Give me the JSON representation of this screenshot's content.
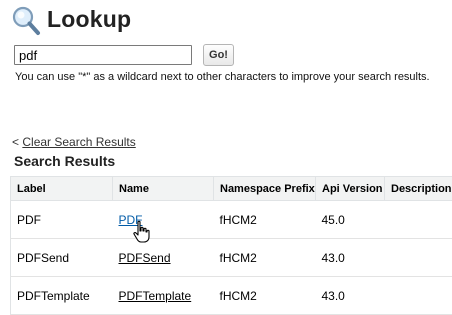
{
  "header": {
    "title": "Lookup",
    "icon": "magnifier-icon"
  },
  "search": {
    "value": "pdf",
    "go_label": "Go!",
    "hint": "You can use \"*\" as a wildcard next to other characters to improve your search results."
  },
  "results": {
    "clear_prefix": "<",
    "clear_label": "Clear Search Results",
    "title": "Search Results",
    "columns": [
      "Label",
      "Name",
      "Namespace Prefix",
      "Api Version",
      "Description"
    ],
    "rows": [
      {
        "label": "PDF",
        "name": "PDF",
        "namespace": "fHCM2",
        "api_version": "45.0",
        "description": ""
      },
      {
        "label": "PDFSend",
        "name": "PDFSend",
        "namespace": "fHCM2",
        "api_version": "43.0",
        "description": ""
      },
      {
        "label": "PDFTemplate",
        "name": "PDFTemplate",
        "namespace": "fHCM2",
        "api_version": "43.0",
        "description": ""
      }
    ]
  },
  "colors": {
    "link_active": "#015ba7",
    "header_row": "#f2f3f3"
  }
}
